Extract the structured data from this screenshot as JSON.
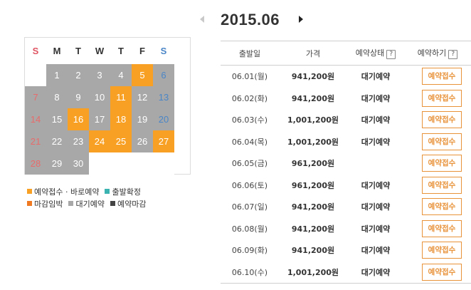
{
  "month_nav": {
    "title": "2015.06"
  },
  "calendar": {
    "weekdays": [
      {
        "label": "S",
        "cls": "sun"
      },
      {
        "label": "M",
        "cls": ""
      },
      {
        "label": "T",
        "cls": ""
      },
      {
        "label": "W",
        "cls": ""
      },
      {
        "label": "T",
        "cls": ""
      },
      {
        "label": "F",
        "cls": ""
      },
      {
        "label": "S",
        "cls": "sat"
      }
    ],
    "weeks": [
      [
        {
          "day": "",
          "state": "empty"
        },
        {
          "day": "1",
          "state": "wait"
        },
        {
          "day": "2",
          "state": "wait"
        },
        {
          "day": "3",
          "state": "wait"
        },
        {
          "day": "4",
          "state": "wait"
        },
        {
          "day": "5",
          "state": "open"
        },
        {
          "day": "6",
          "state": "wait"
        }
      ],
      [
        {
          "day": "7",
          "state": "wait"
        },
        {
          "day": "8",
          "state": "wait"
        },
        {
          "day": "9",
          "state": "wait"
        },
        {
          "day": "10",
          "state": "wait"
        },
        {
          "day": "11",
          "state": "open"
        },
        {
          "day": "12",
          "state": "wait"
        },
        {
          "day": "13",
          "state": "wait"
        }
      ],
      [
        {
          "day": "14",
          "state": "wait"
        },
        {
          "day": "15",
          "state": "wait"
        },
        {
          "day": "16",
          "state": "open"
        },
        {
          "day": "17",
          "state": "wait"
        },
        {
          "day": "18",
          "state": "open"
        },
        {
          "day": "19",
          "state": "wait"
        },
        {
          "day": "20",
          "state": "wait"
        }
      ],
      [
        {
          "day": "21",
          "state": "wait"
        },
        {
          "day": "22",
          "state": "wait"
        },
        {
          "day": "23",
          "state": "wait"
        },
        {
          "day": "24",
          "state": "open"
        },
        {
          "day": "25",
          "state": "open"
        },
        {
          "day": "26",
          "state": "wait"
        },
        {
          "day": "27",
          "state": "open"
        }
      ],
      [
        {
          "day": "28",
          "state": "wait"
        },
        {
          "day": "29",
          "state": "wait"
        },
        {
          "day": "30",
          "state": "wait"
        },
        {
          "day": "",
          "state": "empty"
        },
        {
          "day": "",
          "state": "empty"
        },
        {
          "day": "",
          "state": "empty"
        },
        {
          "day": "",
          "state": "empty"
        }
      ]
    ]
  },
  "legend": [
    [
      {
        "label": "예약접수 · 바로예약",
        "color": "#f8a024"
      },
      {
        "label": "출발확정",
        "color": "#3bb3b0"
      }
    ],
    [
      {
        "label": "마감임박",
        "color": "#f07a22"
      },
      {
        "label": "대기예약",
        "color": "#a8a8a8"
      },
      {
        "label": "예약마감",
        "color": "#444444"
      }
    ]
  ],
  "table": {
    "headers": {
      "date": "출발일",
      "price": "가격",
      "status": "예약상태",
      "action": "예약하기",
      "help": "?"
    },
    "rows": [
      {
        "date": "06.01(월)",
        "price": "941,200원",
        "status": "대기예약",
        "button": "예약접수"
      },
      {
        "date": "06.02(화)",
        "price": "941,200원",
        "status": "대기예약",
        "button": "예약접수"
      },
      {
        "date": "06.03(수)",
        "price": "1,001,200원",
        "status": "대기예약",
        "button": "예약접수"
      },
      {
        "date": "06.04(목)",
        "price": "1,001,200원",
        "status": "대기예약",
        "button": "예약접수"
      },
      {
        "date": "06.05(금)",
        "price": "961,200원",
        "status": "",
        "button": "예약접수"
      },
      {
        "date": "06.06(토)",
        "price": "961,200원",
        "status": "대기예약",
        "button": "예약접수"
      },
      {
        "date": "06.07(일)",
        "price": "941,200원",
        "status": "대기예약",
        "button": "예약접수"
      },
      {
        "date": "06.08(월)",
        "price": "941,200원",
        "status": "대기예약",
        "button": "예약접수"
      },
      {
        "date": "06.09(화)",
        "price": "941,200원",
        "status": "대기예약",
        "button": "예약접수"
      },
      {
        "date": "06.10(수)",
        "price": "1,001,200원",
        "status": "대기예약",
        "button": "예약접수"
      }
    ]
  }
}
